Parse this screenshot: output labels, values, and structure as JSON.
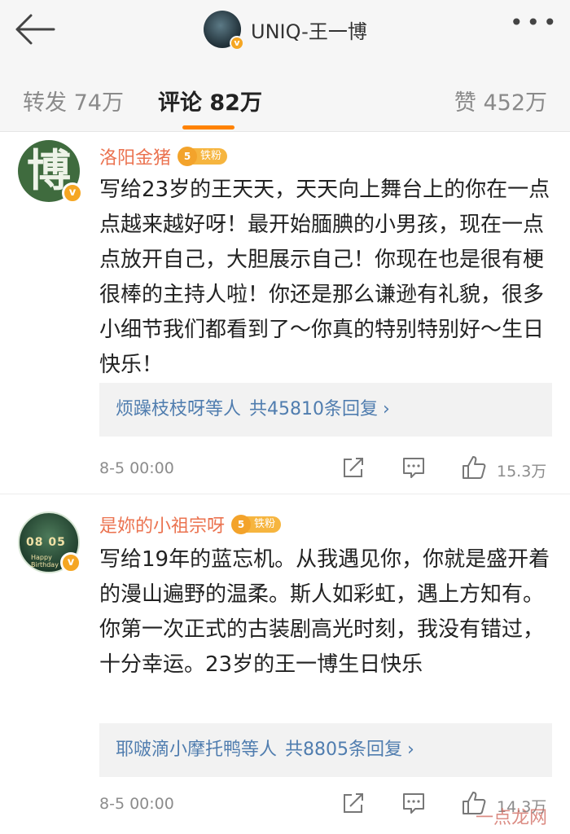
{
  "header": {
    "back_icon": "back-arrow-icon",
    "account_name": "UNIQ-王一博",
    "more_icon": "more-dots-icon"
  },
  "tabs": {
    "forward": "转发 74万",
    "comments": "评论 82万",
    "likes": "赞 452万",
    "active": "comments",
    "indicator_color": "#ff8200"
  },
  "comments": [
    {
      "username": "洛阳金猪",
      "avatar_char": "博",
      "fan_badge": "铁粉",
      "fan_level": "5",
      "verified": "v",
      "text": "写给23岁的王天天，天天向上舞台上的你在一点点越来越好呀！最开始腼腆的小男孩，现在一点点放开自己，大胆展示自己！你现在也是很有梗很棒的主持人啦！你还是那么谦逊有礼貌，很多小细节我们都看到了～你真的特别特别好～生日快乐！",
      "reply_users": "烦躁枝枝呀等人",
      "reply_count": "共45810条回复",
      "reply_chevron": "›",
      "time": "8-5 00:00",
      "like_count": "15.3万"
    },
    {
      "username": "是妳的小祖宗呀",
      "avatar_digits": "08 05",
      "avatar_caption": "Happy Birthday",
      "fan_badge": "铁粉",
      "fan_level": "5",
      "verified": "v",
      "text": "写给19年的蓝忘机。从我遇见你，你就是盛开着的漫山遍野的温柔。斯人如彩虹，遇上方知有。你第一次正式的古装剧高光时刻，我没有错过，十分幸运。23岁的王一博生日快乐",
      "reply_users": "耶啵滴小摩托鸭等人",
      "reply_count": "共8805条回复",
      "reply_chevron": "›",
      "time": "8-5 00:00",
      "like_count": "14.3万"
    }
  ],
  "watermark": "一点龙网",
  "colors": {
    "username": "#eb7350",
    "link": "#507daf",
    "verified_badge": "#f5a623",
    "fan_badge": "#f6b53f"
  }
}
